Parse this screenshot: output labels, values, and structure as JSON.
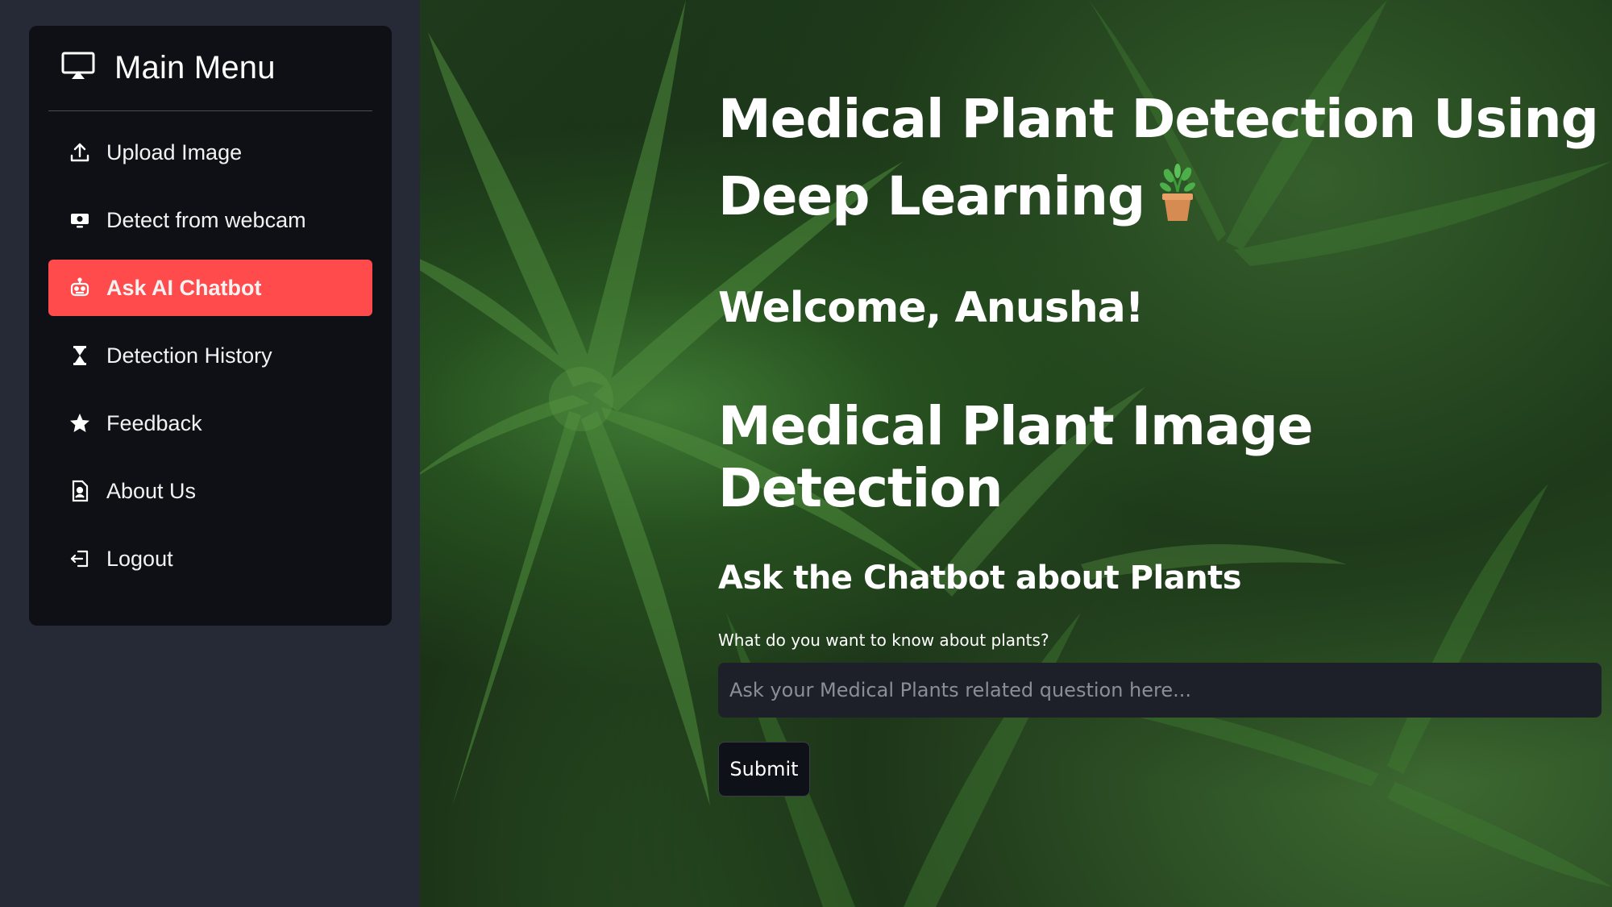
{
  "sidebar": {
    "title": "Main Menu",
    "title_icon": "cast-icon",
    "items": [
      {
        "label": "Upload Image",
        "icon": "upload-icon",
        "active": false
      },
      {
        "label": "Detect from webcam",
        "icon": "webcam-icon",
        "active": false
      },
      {
        "label": "Ask AI Chatbot",
        "icon": "robot-icon",
        "active": true
      },
      {
        "label": "Detection History",
        "icon": "hourglass-icon",
        "active": false
      },
      {
        "label": "Feedback",
        "icon": "star-icon",
        "active": false
      },
      {
        "label": "About Us",
        "icon": "document-icon",
        "active": false
      },
      {
        "label": "Logout",
        "icon": "logout-icon",
        "active": false
      }
    ]
  },
  "main": {
    "title": "Medical Plant Detection Using Deep Learning",
    "title_emoji": "potted-plant-icon",
    "welcome": "Welcome, Anusha!",
    "section_title": "Medical Plant Image Detection",
    "chat_title": "Ask the Chatbot about Plants",
    "question_label": "What do you want to know about plants?",
    "question_value": "",
    "question_placeholder": "Ask your Medical Plants related question here...",
    "submit_label": "Submit"
  },
  "colors": {
    "accent": "#ff4b4b",
    "sidebar_bg": "#262a37",
    "menu_bg": "#0f1016",
    "input_bg": "#1d2029",
    "button_bg": "#0e1117"
  }
}
